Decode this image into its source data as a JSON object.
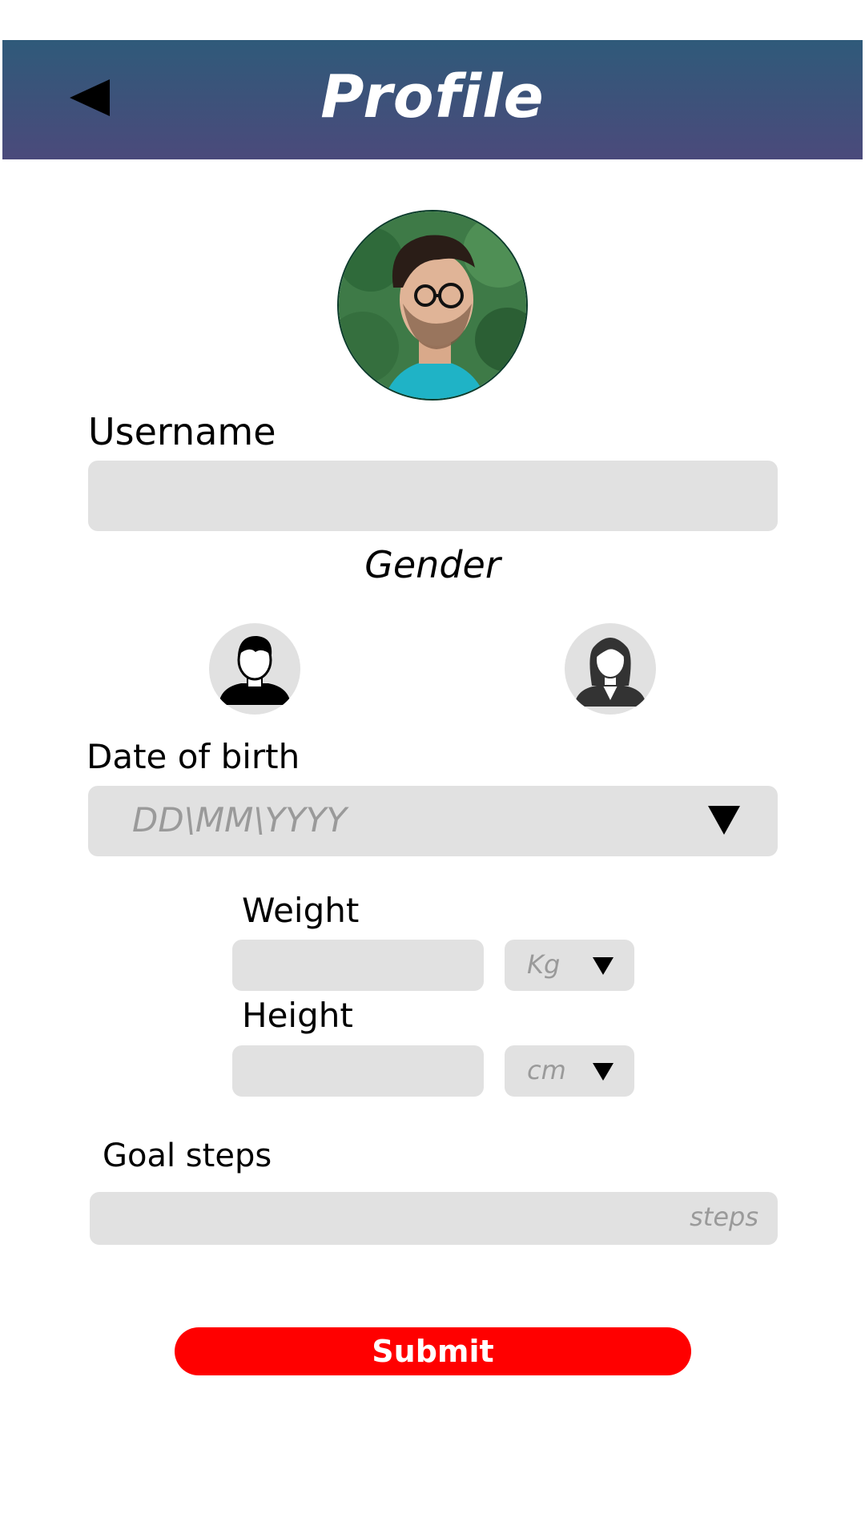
{
  "header": {
    "title": "Profile"
  },
  "form": {
    "username_label": "Username",
    "gender_label": "Gender",
    "dob_label": "Date of birth",
    "dob_placeholder": "DD\\MM\\YYYY",
    "weight_label": "Weight",
    "weight_unit": "Kg",
    "height_label": "Height",
    "height_unit": "cm",
    "goal_label": "Goal steps",
    "goal_placeholder": "steps",
    "submit_label": "Submit"
  },
  "colors": {
    "header_top": "#2f5a7a",
    "header_bottom": "#4b4a7b",
    "field_bg": "#e1e1e1",
    "submit_bg": "#ff0000"
  },
  "icons": [
    "back-arrow-icon",
    "profile-photo",
    "male-avatar-icon",
    "female-avatar-icon",
    "dropdown-arrow-icon"
  ]
}
